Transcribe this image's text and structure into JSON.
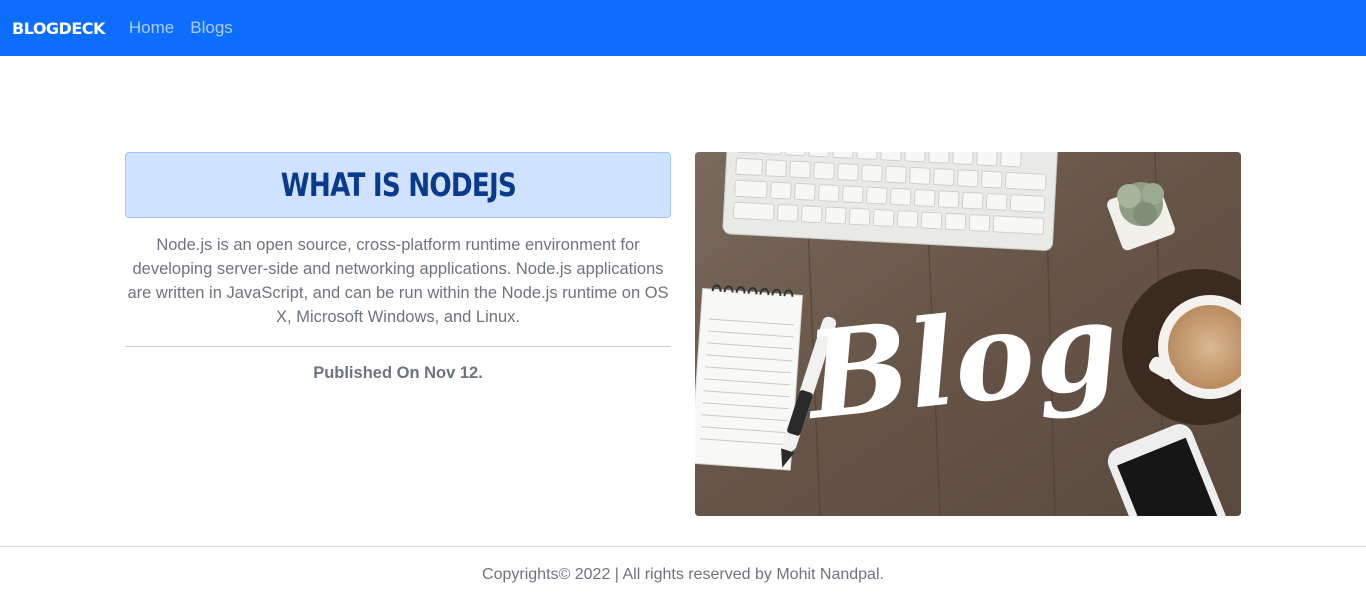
{
  "navbar": {
    "brand": "BLOGDECK",
    "links": [
      "Home",
      "Blogs"
    ],
    "bg_color": "#0d6efd"
  },
  "post": {
    "title": "WHAT IS NODEJS",
    "description": "Node.js is an open source, cross-platform runtime environment for developing server-side and networking applications. Node.js applications are written in JavaScript, and can be run within the Node.js runtime on OS X, Microsoft Windows, and Linux.",
    "published": "Published On Nov 12.",
    "image_text": "Blog",
    "title_box_color": "#cfe2ff",
    "title_color": "#0a3a8c"
  },
  "footer": {
    "text": "Copyrights© 2022 | All rights reserved by Mohit Nandpal."
  }
}
